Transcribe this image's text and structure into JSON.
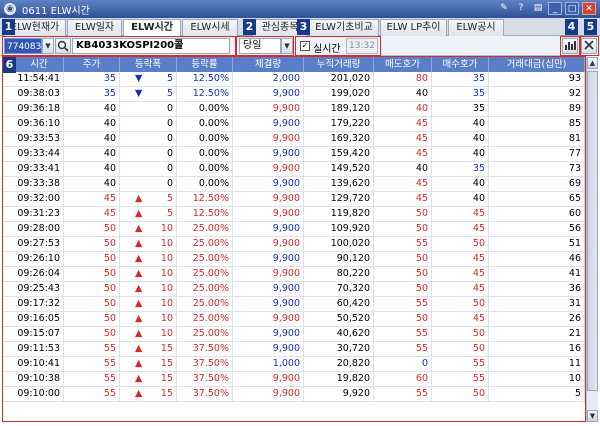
{
  "window": {
    "title": "0611 ELW시간"
  },
  "tabs": [
    {
      "label": "ELW현재가",
      "active": false
    },
    {
      "label": "ELW일자",
      "active": false
    },
    {
      "label": "ELW시간",
      "active": true
    },
    {
      "label": "ELW시세",
      "active": false
    },
    {
      "label": "관심종목",
      "active": false
    },
    {
      "label": "ELW기초비교",
      "active": false
    },
    {
      "label": "ELW LP추이",
      "active": false
    },
    {
      "label": "ELW공시",
      "active": false
    }
  ],
  "badges": [
    "1",
    "2",
    "3",
    "4",
    "5",
    "6"
  ],
  "toolbar": {
    "code": "774083",
    "name": "KB4033KOSPI200콜",
    "period": "당일",
    "realtime_label": "실시간",
    "realtime_checked": "✓",
    "realtime_time": "13:32"
  },
  "columns": [
    "시간",
    "주가",
    "등락폭",
    "등락률",
    "체결량",
    "누적거래량",
    "매도호가",
    "매수호가",
    "거래대금(십만)"
  ],
  "rows": [
    [
      "11:54:41",
      "35",
      "▼",
      "5",
      "12.50%",
      "2,000",
      "201,020",
      "80",
      "35",
      "93"
    ],
    [
      "09:38:03",
      "35",
      "▼",
      "5",
      "12.50%",
      "9,900",
      "199,020",
      "40",
      "35",
      "92"
    ],
    [
      "09:36:18",
      "40",
      "",
      "0",
      "0.00%",
      "9,900",
      "189,120",
      "40",
      "35",
      "89"
    ],
    [
      "09:36:10",
      "40",
      "",
      "0",
      "0.00%",
      "9,900",
      "179,220",
      "45",
      "40",
      "85"
    ],
    [
      "09:33:53",
      "40",
      "",
      "0",
      "0.00%",
      "9,900",
      "169,320",
      "45",
      "40",
      "81"
    ],
    [
      "09:33:44",
      "40",
      "",
      "0",
      "0.00%",
      "9,900",
      "159,420",
      "45",
      "40",
      "77"
    ],
    [
      "09:33:41",
      "40",
      "",
      "0",
      "0.00%",
      "9,900",
      "149,520",
      "40",
      "35",
      "73"
    ],
    [
      "09:33:38",
      "40",
      "",
      "0",
      "0.00%",
      "9,900",
      "139,620",
      "45",
      "40",
      "69"
    ],
    [
      "09:32:00",
      "45",
      "▲",
      "5",
      "12.50%",
      "9,900",
      "129,720",
      "45",
      "40",
      "65"
    ],
    [
      "09:31:23",
      "45",
      "▲",
      "5",
      "12.50%",
      "9,900",
      "119,820",
      "50",
      "45",
      "60"
    ],
    [
      "09:28:00",
      "50",
      "▲",
      "10",
      "25.00%",
      "9,900",
      "109,920",
      "50",
      "45",
      "56"
    ],
    [
      "09:27:53",
      "50",
      "▲",
      "10",
      "25.00%",
      "9,900",
      "100,020",
      "55",
      "50",
      "51"
    ],
    [
      "09:26:10",
      "50",
      "▲",
      "10",
      "25.00%",
      "9,900",
      "90,120",
      "50",
      "45",
      "46"
    ],
    [
      "09:26:04",
      "50",
      "▲",
      "10",
      "25.00%",
      "9,900",
      "80,220",
      "50",
      "45",
      "41"
    ],
    [
      "09:25:43",
      "50",
      "▲",
      "10",
      "25.00%",
      "9,900",
      "70,320",
      "50",
      "45",
      "36"
    ],
    [
      "09:17:32",
      "50",
      "▲",
      "10",
      "25.00%",
      "9,900",
      "60,420",
      "55",
      "50",
      "31"
    ],
    [
      "09:16:05",
      "50",
      "▲",
      "10",
      "25.00%",
      "9,900",
      "50,520",
      "50",
      "45",
      "26"
    ],
    [
      "09:15:07",
      "50",
      "▲",
      "10",
      "25.00%",
      "9,900",
      "40,620",
      "55",
      "50",
      "21"
    ],
    [
      "09:11:53",
      "55",
      "▲",
      "15",
      "37.50%",
      "9,900",
      "30,720",
      "55",
      "50",
      "16"
    ],
    [
      "09:10:41",
      "55",
      "▲",
      "15",
      "37.50%",
      "1,000",
      "20,820",
      "0",
      "55",
      "11"
    ],
    [
      "09:10:38",
      "55",
      "▲",
      "15",
      "37.50%",
      "9,900",
      "19,820",
      "60",
      "55",
      "10"
    ],
    [
      "09:10:00",
      "55",
      "▲",
      "15",
      "37.50%",
      "9,900",
      "9,920",
      "55",
      "50",
      "5"
    ]
  ],
  "row_colors": [
    [
      "bk",
      "dn",
      "dn",
      "dn",
      "blu",
      "bk",
      "red",
      "blu",
      "bk"
    ],
    [
      "bk",
      "dn",
      "dn",
      "dn",
      "blu",
      "bk",
      "bk",
      "blu",
      "bk"
    ],
    [
      "bk",
      "bk",
      "bk",
      "bk",
      "red",
      "bk",
      "red",
      "bk",
      "bk"
    ],
    [
      "bk",
      "bk",
      "bk",
      "bk",
      "blu",
      "bk",
      "red",
      "bk",
      "bk"
    ],
    [
      "bk",
      "bk",
      "bk",
      "bk",
      "red",
      "bk",
      "red",
      "bk",
      "bk"
    ],
    [
      "bk",
      "bk",
      "bk",
      "bk",
      "blu",
      "bk",
      "red",
      "bk",
      "bk"
    ],
    [
      "bk",
      "bk",
      "bk",
      "bk",
      "red",
      "bk",
      "bk",
      "blu",
      "bk"
    ],
    [
      "bk",
      "bk",
      "bk",
      "bk",
      "blu",
      "bk",
      "red",
      "bk",
      "bk"
    ],
    [
      "bk",
      "up",
      "up",
      "up",
      "red",
      "bk",
      "red",
      "bk",
      "bk"
    ],
    [
      "bk",
      "up",
      "up",
      "up",
      "red",
      "bk",
      "red",
      "red",
      "bk"
    ],
    [
      "bk",
      "up",
      "up",
      "up",
      "blu",
      "bk",
      "red",
      "red",
      "bk"
    ],
    [
      "bk",
      "up",
      "up",
      "up",
      "red",
      "bk",
      "red",
      "red",
      "bk"
    ],
    [
      "bk",
      "up",
      "up",
      "up",
      "blu",
      "bk",
      "red",
      "red",
      "bk"
    ],
    [
      "bk",
      "up",
      "up",
      "up",
      "red",
      "bk",
      "red",
      "red",
      "bk"
    ],
    [
      "bk",
      "up",
      "up",
      "up",
      "blu",
      "bk",
      "red",
      "red",
      "bk"
    ],
    [
      "bk",
      "up",
      "up",
      "up",
      "blu",
      "bk",
      "red",
      "red",
      "bk"
    ],
    [
      "bk",
      "up",
      "up",
      "up",
      "red",
      "bk",
      "red",
      "red",
      "bk"
    ],
    [
      "bk",
      "up",
      "up",
      "up",
      "blu",
      "bk",
      "red",
      "red",
      "bk"
    ],
    [
      "bk",
      "up",
      "up",
      "up",
      "blu",
      "bk",
      "red",
      "red",
      "bk"
    ],
    [
      "bk",
      "up",
      "up",
      "up",
      "blu",
      "bk",
      "blu",
      "red",
      "bk"
    ],
    [
      "bk",
      "up",
      "up",
      "up",
      "red",
      "bk",
      "red",
      "red",
      "bk"
    ],
    [
      "bk",
      "up",
      "up",
      "up",
      "red",
      "bk",
      "red",
      "red",
      "bk"
    ]
  ],
  "colors": {
    "up": "#d42a2a",
    "down": "#1530b8",
    "header_bg": "#5a7ec8",
    "badge_bg": "#163a8a"
  },
  "icons": [
    "window-app-icon",
    "search-icon",
    "chart-bar-icon",
    "expand-icon",
    "minimize-icon",
    "maximize-icon",
    "close-icon"
  ]
}
